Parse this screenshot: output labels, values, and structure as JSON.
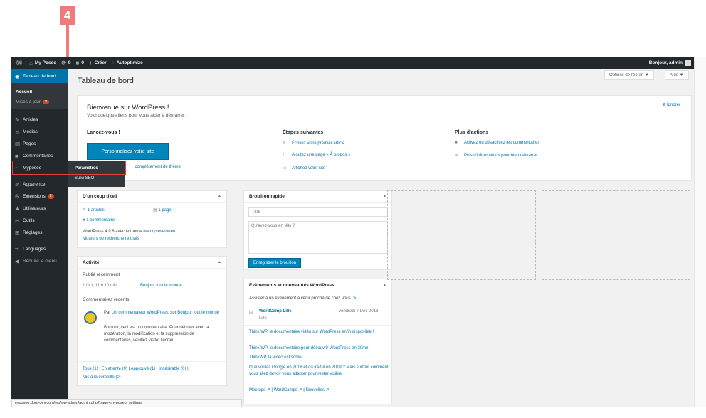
{
  "annotation": {
    "step_number": "4"
  },
  "adminbar": {
    "site_name": "My Poseo",
    "updates_count": "9",
    "comments_count": "0",
    "new_label": "Créer",
    "plugin_label": "Autoptimize",
    "greeting": "Bonjour, admin"
  },
  "sidebar": {
    "dashboard": "Tableau de bord",
    "home": "Accueil",
    "updates": "Mises à jour",
    "updates_badge": "9",
    "items": [
      {
        "label": "Articles",
        "icon": "pin-icon"
      },
      {
        "label": "Médias",
        "icon": "media-icon"
      },
      {
        "label": "Pages",
        "icon": "page-icon"
      },
      {
        "label": "Commentaires",
        "icon": "comment-icon"
      }
    ],
    "myposeo": "Myposeo",
    "items2": [
      {
        "label": "Apparence",
        "icon": "brush-icon"
      },
      {
        "label": "Extensions",
        "icon": "plugin-icon",
        "badge": "8"
      },
      {
        "label": "Utilisateurs",
        "icon": "users-icon"
      },
      {
        "label": "Outils",
        "icon": "tools-icon"
      },
      {
        "label": "Réglages",
        "icon": "settings-icon"
      }
    ],
    "languages": "Languages",
    "collapse": "Réduire le menu"
  },
  "flyout": {
    "item1": "Paramètres",
    "item2": "Suivi SEO"
  },
  "header": {
    "title": "Tableau de bord",
    "screen_options": "Options de l'écran ▼",
    "help": "Aide ▼"
  },
  "welcome": {
    "title": "Bienvenue sur WordPress !",
    "about": "Voici quelques liens pour vous aider à démarrer :",
    "dismiss": "Ignorer",
    "col1_title": "Lancez-vous !",
    "cta": "Personnalisez votre site",
    "theme_link": "complètement de thème",
    "col2_title": "Étapes suivantes",
    "next_steps": [
      "Écrivez votre premier article",
      "Ajoutez une page « À propos »",
      "Affichez votre site"
    ],
    "col3_title": "Plus d'actions",
    "more_actions": [
      "Activez ou désactivez les commentaires",
      "Plus d'informations pour bien démarrer"
    ]
  },
  "glance": {
    "title": "D'un coup d'œil",
    "articles": "1 articles",
    "pages": "1 page",
    "comments": "1 commentaire",
    "wp_version_prefix": "WordPress 4.9.8 avec le thème ",
    "theme_name": "twentyseventeen",
    "search_engines": "Moteurs de recherche refusés"
  },
  "activity": {
    "title": "Activité",
    "recent_published": "Publié récemment",
    "post_date": "1 Oct, 11 h 10 min",
    "post_title": "Bonjour tout le monde !",
    "recent_comments": "Commentaires récents",
    "comment_from": "Par ",
    "commenter": "Un commentateur WordPress",
    "comment_on": ", sur ",
    "comment_post": "Bonjour tout le monde !",
    "comment_excerpt": "Bonjour, ceci est un commentaire. Pour débuter avec la modération, la modification et la suppression de commentaires, veuillez visiter l'écran…",
    "filter_all": "Tous (1)",
    "filter_pending": "En attente (0)",
    "filter_approved": "Approuvé (1)",
    "filter_spam": "Indésirable (0)",
    "filter_trash": "Mis à la corbeille (0)"
  },
  "quickdraft": {
    "title": "Brouillon rapide",
    "title_placeholder": "Titre",
    "content_placeholder": "Qu'avez-vous en tête ?",
    "save_label": "Enregistrer le brouillon"
  },
  "events": {
    "title": "Évènements et nouveautés WordPress",
    "attend": "Assister à un évènement à venir proche de chez vous.",
    "event_name": "WordCamp Lille",
    "event_city": "Lille",
    "event_date": "vendredi 7 Déc 2018",
    "news": [
      "Think WP, le documentaire vidéo sur WordPress enfin disponible !",
      "Think WP, le documentaire pour découvrir WordPress en 30mn",
      "ThinkWP, la vidéo est sortie!",
      "Que voulait Google en 2018 et où ira-t-il en 2019 ? Mais surtout comment vous allez devoir vous adapter pour rester visible."
    ],
    "footer_links": [
      "Meetups",
      "WordCamps",
      "Nouvelles"
    ]
  },
  "statusbar": {
    "url": "myposeo.dbm-dev.com/wp/wp-admin/admin.php?page=myposeo_settings"
  },
  "colors": {
    "accent": "#0073aa",
    "button": "#0085ba",
    "adminbar": "#23282d",
    "highlight": "#e53e3e",
    "marker": "#f07b7b"
  }
}
